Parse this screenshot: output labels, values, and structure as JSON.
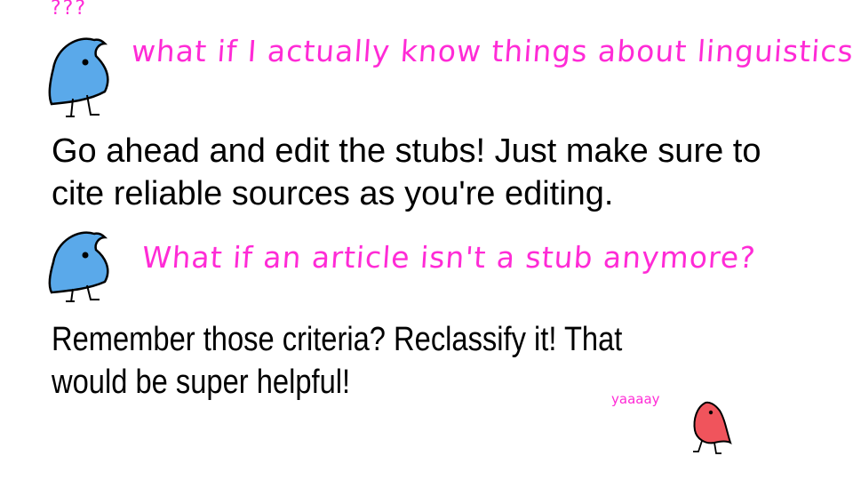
{
  "slide": {
    "question_marks": "???",
    "question_1": "what if I actually know things about linguistics?",
    "answer_1": [
      "Go ahead and edit the stubs! Just make sure to",
      "cite reliable sources as you're editing."
    ],
    "question_2": "What if an article isn't a stub anymore?",
    "answer_2": [
      "Remember those criteria? Reclassify it! That",
      "would be super helpful!"
    ],
    "celebration": "yaaaay"
  },
  "colors": {
    "handwriting": "#ff2bd6",
    "blue_bird": "#5aa9ea",
    "red_bird": "#f0545c"
  },
  "icons": {
    "bird_1": "blue-bird-icon",
    "bird_2": "blue-bird-icon",
    "bird_3": "red-bird-icon"
  }
}
